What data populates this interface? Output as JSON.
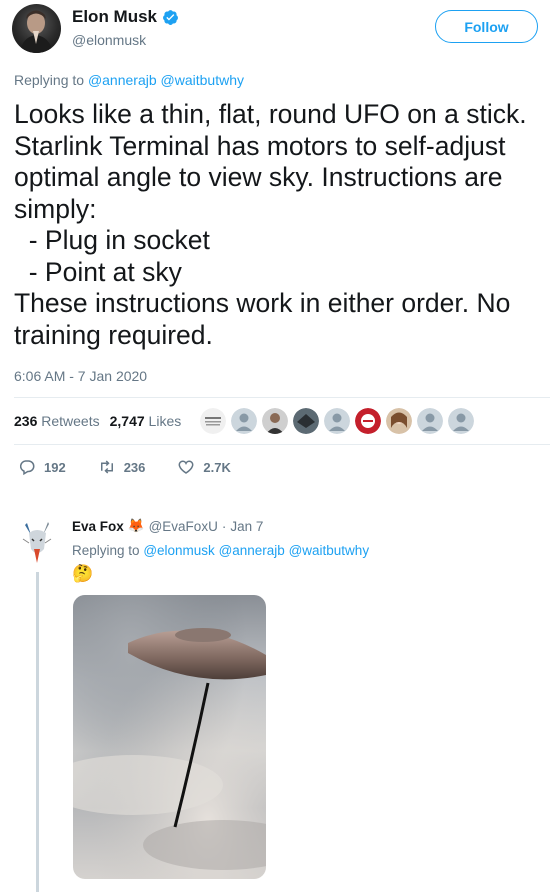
{
  "author": {
    "name": "Elon Musk",
    "handle": "@elonmusk",
    "verified_icon": "verified-badge-icon"
  },
  "follow_label": "Follow",
  "replying": {
    "prefix": "Replying to",
    "mentions": [
      "@annerajb",
      "@waitbutwhy"
    ]
  },
  "tweet_text": "Looks like a thin, flat, round UFO on a stick. Starlink Terminal has motors to self-adjust optimal angle to view sky. Instructions are simply:\n  - Plug in socket\n  - Point at sky\nThese instructions work in either order. No training required.",
  "timestamp": "6:06 AM - 7 Jan 2020",
  "stats": {
    "retweets_count": "236",
    "retweets_label": "Retweets",
    "likes_count": "2,747",
    "likes_label": "Likes"
  },
  "actions": {
    "reply_count": "192",
    "retweet_count": "236",
    "like_count": "2.7K"
  },
  "reply": {
    "name": "Eva Fox",
    "name_emoji": "🦊",
    "handle": "@EvaFoxU",
    "separator": "·",
    "date": "Jan 7",
    "replying_prefix": "Replying to",
    "mentions": [
      "@elonmusk",
      "@annerajb",
      "@waitbutwhy"
    ],
    "emoji": "🤔"
  },
  "colors": {
    "accent": "#1da1f2",
    "muted": "#657786",
    "text": "#14171a",
    "divider": "#e6ecf0"
  }
}
